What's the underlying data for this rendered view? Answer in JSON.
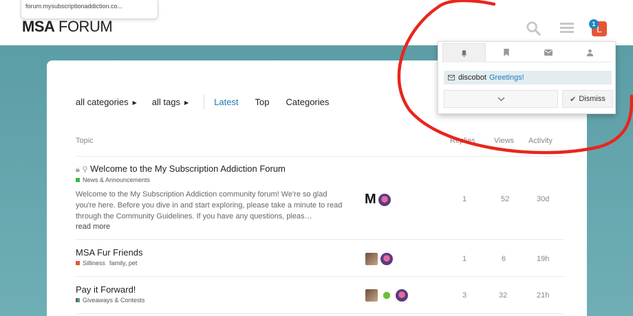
{
  "url_tooltip": "forum.mysubscriptionaddiction.co...",
  "logo": {
    "bold": "MSA",
    "light": " FORUM"
  },
  "header": {
    "notification_count": "1",
    "avatar_letter": "L"
  },
  "nav": {
    "categories_dropdown": "all categories",
    "tags_dropdown": "all tags",
    "tabs": [
      "Latest",
      "Top",
      "Categories"
    ],
    "active_tab": "Latest"
  },
  "table": {
    "columns": [
      "Topic",
      "Replies",
      "Views",
      "Activity"
    ],
    "rows": [
      {
        "title": "Welcome to the My Subscription Addiction Forum",
        "category": "News & Announcements",
        "category_color": "#3ab54a",
        "excerpt": "Welcome to the My Subscription Addiction community forum! We're so glad you're here. Before you dive in and start exploring, please take a minute to read through the Community Guidelines. If you have any questions, pleas…",
        "read_more": "read more",
        "replies": "1",
        "views": "52",
        "activity": "30d"
      },
      {
        "title": "MSA Fur Friends",
        "category": "Silliness",
        "category_color": "#e45735",
        "tags": "family, pet",
        "replies": "1",
        "views": "6",
        "activity": "19h"
      },
      {
        "title": "Pay it Forward!",
        "category": "Giveaways & Contests",
        "category_color": "#8e44ad",
        "replies": "3",
        "views": "32",
        "activity": "21h"
      }
    ]
  },
  "notifications_panel": {
    "tab_icons": [
      "bell-icon",
      "bookmark-icon",
      "envelope-icon",
      "user-icon"
    ],
    "item_user": "discobot",
    "item_text": "Greetings!",
    "dismiss_label": "Dismiss"
  },
  "colors": {
    "accent": "#1e7ab8",
    "teal_bg": "#66a6ae",
    "avatar_bg": "#e45735",
    "annotation_circle": "#e8261c"
  }
}
